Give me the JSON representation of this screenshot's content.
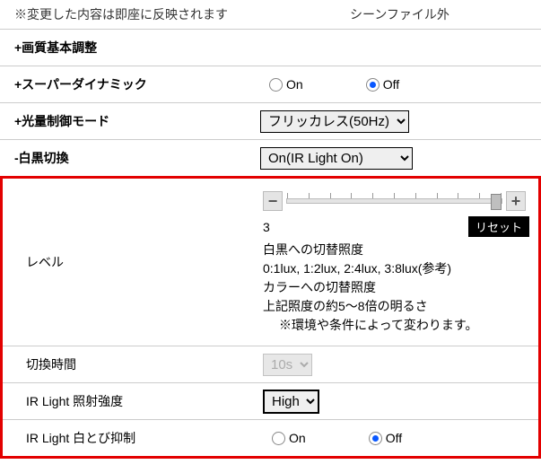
{
  "notes": {
    "left": "※変更した内容は即座に反映されます",
    "right": "シーンファイル外"
  },
  "sections": {
    "quality": "+画質基本調整",
    "superdynamic": {
      "label": "+スーパーダイナミック",
      "on": "On",
      "off": "Off",
      "value": "off"
    },
    "lightcontrol": {
      "label": "+光量制御モード",
      "selected": "フリッカレス(50Hz)"
    },
    "bw": {
      "label": "-白黒切換",
      "selected": "On(IR Light On)"
    }
  },
  "level": {
    "label": "レベル",
    "value": "3",
    "reset": "リセット",
    "line1": "白黒への切替照度",
    "line2": "0:1lux, 1:2lux, 2:4lux, 3:8lux(参考)",
    "line3": "カラーへの切替照度",
    "line4": "上記照度の約5～8倍の明るさ",
    "line5": "※環境や条件によって変わります。"
  },
  "switchtime": {
    "label": "切換時間",
    "selected": "10s"
  },
  "irlight_intensity": {
    "label": "IR Light 照射強度",
    "selected": "High"
  },
  "irlight_whiteout": {
    "label": "IR Light 白とび抑制",
    "on": "On",
    "off": "Off",
    "value": "off"
  }
}
